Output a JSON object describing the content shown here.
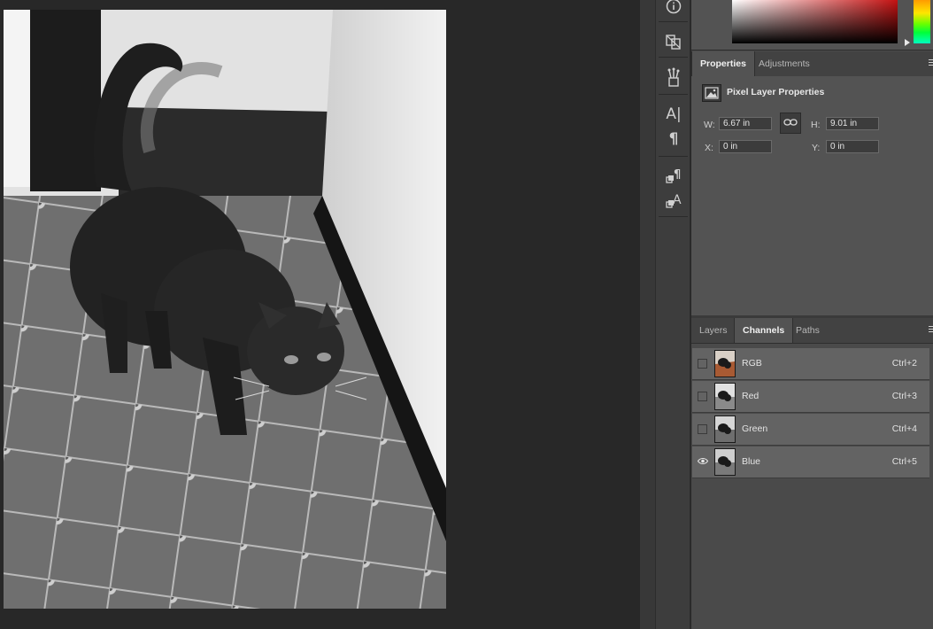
{
  "document": {
    "image_alt": "Black and white photo of a black cat standing on a tiled floor next to a wall"
  },
  "tool_strip": {
    "tools": [
      {
        "name": "info",
        "icon": "info-icon"
      },
      {
        "name": "libraries",
        "icon": "libraries-icon"
      },
      {
        "name": "brush-presets",
        "icon": "brush-icon"
      },
      {
        "name": "character",
        "icon": "character-icon"
      },
      {
        "name": "paragraph",
        "icon": "paragraph-icon"
      },
      {
        "name": "paragraph-styles",
        "icon": "paragraph-styles-icon"
      },
      {
        "name": "character-styles",
        "icon": "character-styles-icon"
      }
    ],
    "character_glyph": "A|",
    "paragraph_glyph": "¶"
  },
  "color_panel": {
    "field_hue": "#c41212",
    "hue_bar_top": "#ff9a00"
  },
  "properties_panel": {
    "tabs": [
      {
        "label": "Properties",
        "active": true
      },
      {
        "label": "Adjustments",
        "active": false
      }
    ],
    "title": "Pixel Layer Properties",
    "w_label": "W:",
    "w_value": "6.67 in",
    "h_label": "H:",
    "h_value": "9.01 in",
    "x_label": "X:",
    "x_value": "0 in",
    "y_label": "Y:",
    "y_value": "0 in"
  },
  "channels_panel": {
    "tabs": [
      {
        "label": "Layers",
        "active": false
      },
      {
        "label": "Channels",
        "active": true
      },
      {
        "label": "Paths",
        "active": false
      }
    ],
    "channels": [
      {
        "name": "RGB",
        "shortcut": "Ctrl+2",
        "visible": false,
        "thumb": "color"
      },
      {
        "name": "Red",
        "shortcut": "Ctrl+3",
        "visible": false,
        "thumb": "gray"
      },
      {
        "name": "Green",
        "shortcut": "Ctrl+4",
        "visible": false,
        "thumb": "gray"
      },
      {
        "name": "Blue",
        "shortcut": "Ctrl+5",
        "visible": true,
        "thumb": "gray"
      }
    ]
  }
}
